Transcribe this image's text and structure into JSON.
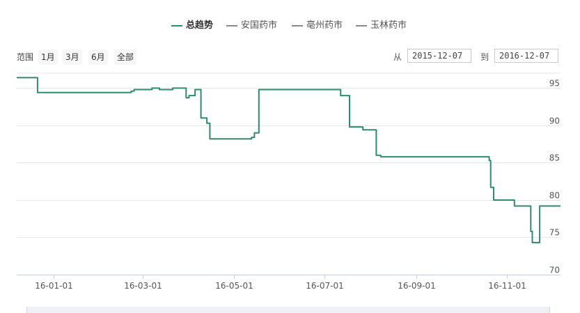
{
  "legend": [
    {
      "label": "总趋势",
      "color": "#2e8b6e",
      "active": true
    },
    {
      "label": "安国药市",
      "color": "#888888",
      "active": false
    },
    {
      "label": "亳州药市",
      "color": "#888888",
      "active": false
    },
    {
      "label": "玉林药市",
      "color": "#888888",
      "active": false
    }
  ],
  "range_selector": {
    "label": "范围",
    "buttons": [
      "1月",
      "3月",
      "6月",
      "全部"
    ],
    "from_label": "从",
    "from_date": "2015-12-07",
    "to_label": "到",
    "to_date": "2016-12-07"
  },
  "chart_data": {
    "type": "line",
    "title": "",
    "xlabel": "",
    "ylabel": "",
    "x_range": [
      "2015-12-07",
      "2016-12-07"
    ],
    "ylim": [
      70,
      97
    ],
    "y_ticks": [
      70,
      75,
      80,
      85,
      90,
      95
    ],
    "x_ticks": [
      {
        "date": "2016-01-01",
        "label": "16-01-01"
      },
      {
        "date": "2016-03-01",
        "label": "16-03-01"
      },
      {
        "date": "2016-05-01",
        "label": "16-05-01"
      },
      {
        "date": "2016-07-01",
        "label": "16-07-01"
      },
      {
        "date": "2016-09-01",
        "label": "16-09-01"
      },
      {
        "date": "2016-11-01",
        "label": "16-11-01"
      }
    ],
    "grid": true,
    "legend_position": "top-center",
    "series": [
      {
        "name": "总趋势",
        "color": "#2e8b6e",
        "step": true,
        "points": [
          [
            "2015-12-07",
            96.4
          ],
          [
            "2015-12-21",
            94.4
          ],
          [
            "2016-02-22",
            94.6
          ],
          [
            "2016-02-24",
            94.8
          ],
          [
            "2016-03-07",
            95.0
          ],
          [
            "2016-03-12",
            94.8
          ],
          [
            "2016-03-21",
            95.0
          ],
          [
            "2016-03-30",
            93.7
          ],
          [
            "2016-04-01",
            94.0
          ],
          [
            "2016-04-05",
            94.8
          ],
          [
            "2016-04-09",
            91.0
          ],
          [
            "2016-04-13",
            90.3
          ],
          [
            "2016-04-15",
            88.2
          ],
          [
            "2016-05-13",
            88.4
          ],
          [
            "2016-05-15",
            89.0
          ],
          [
            "2016-05-18",
            94.8
          ],
          [
            "2016-07-12",
            94.0
          ],
          [
            "2016-07-18",
            89.8
          ],
          [
            "2016-07-27",
            89.4
          ],
          [
            "2016-08-05",
            86.0
          ],
          [
            "2016-08-08",
            85.8
          ],
          [
            "2016-10-20",
            85.3
          ],
          [
            "2016-10-21",
            81.7
          ],
          [
            "2016-10-23",
            80.0
          ],
          [
            "2016-11-06",
            79.2
          ],
          [
            "2016-11-17",
            75.8
          ],
          [
            "2016-11-18",
            74.3
          ],
          [
            "2016-11-23",
            79.2
          ],
          [
            "2016-12-07",
            79.2
          ]
        ]
      }
    ]
  }
}
